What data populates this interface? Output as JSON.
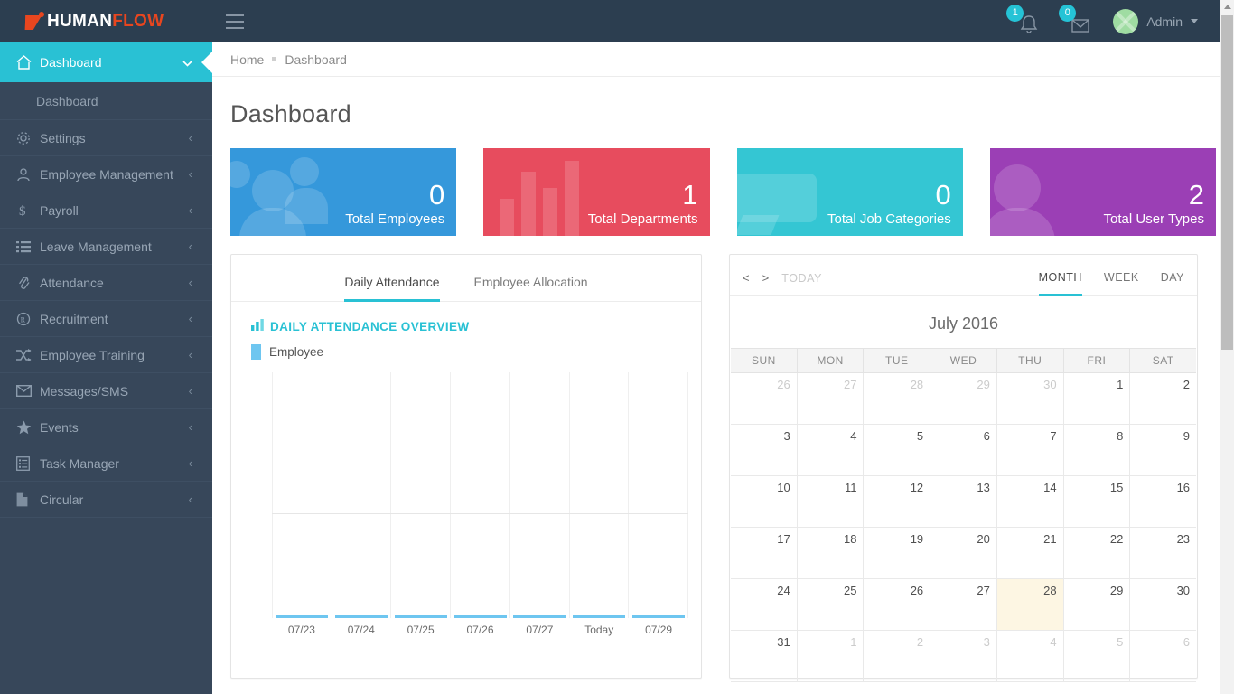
{
  "brand": {
    "name_a": "HUMAN",
    "name_b": "FLOW",
    "logo_icon": "flow-mark-icon"
  },
  "topbar": {
    "menu_toggle": "hamburger-icon",
    "notifications": {
      "icon": "bell-icon",
      "count": "1"
    },
    "messages": {
      "icon": "envelope-icon",
      "count": "0"
    },
    "user": {
      "name": "Admin",
      "avatar": "avatar",
      "caret": "chevron-down-icon"
    }
  },
  "sidebar": {
    "active": {
      "label": "Dashboard",
      "icon": "home-icon",
      "chevron": "chevron-down-icon"
    },
    "submenu": [
      {
        "label": "Dashboard"
      }
    ],
    "items": [
      {
        "label": "Settings",
        "icon": "gear-icon",
        "arrow": "chevron-left-icon"
      },
      {
        "label": "Employee Management",
        "icon": "user-group-icon",
        "arrow": "chevron-left-icon"
      },
      {
        "label": "Payroll",
        "icon": "dollar-icon",
        "arrow": "chevron-left-icon"
      },
      {
        "label": "Leave Management",
        "icon": "list-icon",
        "arrow": "chevron-left-icon"
      },
      {
        "label": "Attendance",
        "icon": "paperclip-icon",
        "arrow": "chevron-left-icon"
      },
      {
        "label": "Recruitment",
        "icon": "registered-icon",
        "arrow": "chevron-left-icon"
      },
      {
        "label": "Employee Training",
        "icon": "shuffle-icon",
        "arrow": "chevron-left-icon"
      },
      {
        "label": "Messages/SMS",
        "icon": "mail-icon",
        "arrow": "chevron-left-icon"
      },
      {
        "label": "Events",
        "icon": "star-icon",
        "arrow": "chevron-left-icon"
      },
      {
        "label": "Task Manager",
        "icon": "tasks-icon",
        "arrow": "chevron-left-icon"
      },
      {
        "label": "Circular",
        "icon": "file-icon",
        "arrow": "chevron-left-icon"
      }
    ]
  },
  "breadcrumb": {
    "home": "Home",
    "current": "Dashboard"
  },
  "page": {
    "title": "Dashboard"
  },
  "cards": [
    {
      "value": "0",
      "label": "Total Employees",
      "color": "#3598db",
      "icon": "people-icon"
    },
    {
      "value": "1",
      "label": "Total Departments",
      "color": "#e74c5e",
      "icon": "bar-chart-icon"
    },
    {
      "value": "0",
      "label": "Total Job Categories",
      "color": "#34c6d3",
      "icon": "screen-icon"
    },
    {
      "value": "2",
      "label": "Total User Types",
      "color": "#9b3fb5",
      "icon": "user-icon"
    }
  ],
  "chart_panel": {
    "tabs": [
      {
        "label": "Daily Attendance",
        "active": true
      },
      {
        "label": "Employee Allocation",
        "active": false
      }
    ],
    "heading": "DAILY ATTENDANCE OVERVIEW",
    "heading_icon": "bar-chart-icon",
    "legend_label": "Employee"
  },
  "chart_data": {
    "type": "bar",
    "title": "DAILY ATTENDANCE OVERVIEW",
    "categories": [
      "07/23",
      "07/24",
      "07/25",
      "07/26",
      "07/27",
      "Today",
      "07/29"
    ],
    "series": [
      {
        "name": "Employee",
        "color": "#6ec6f0",
        "values": [
          0,
          0,
          0,
          0,
          0,
          0,
          0
        ]
      }
    ],
    "xlabel": "",
    "ylabel": "",
    "ylim": [
      0,
      1
    ],
    "grid": "vertical",
    "legend_position": "top-left"
  },
  "calendar": {
    "prev": "<",
    "next": ">",
    "today_button": "TODAY",
    "views": [
      {
        "label": "MONTH",
        "active": true
      },
      {
        "label": "WEEK",
        "active": false
      },
      {
        "label": "DAY",
        "active": false
      }
    ],
    "title": "July 2016",
    "dow": [
      "SUN",
      "MON",
      "TUE",
      "WED",
      "THU",
      "FRI",
      "SAT"
    ],
    "weeks": [
      [
        {
          "d": "26",
          "o": true
        },
        {
          "d": "27",
          "o": true
        },
        {
          "d": "28",
          "o": true
        },
        {
          "d": "29",
          "o": true
        },
        {
          "d": "30",
          "o": true
        },
        {
          "d": "1"
        },
        {
          "d": "2"
        }
      ],
      [
        {
          "d": "3"
        },
        {
          "d": "4"
        },
        {
          "d": "5"
        },
        {
          "d": "6"
        },
        {
          "d": "7"
        },
        {
          "d": "8"
        },
        {
          "d": "9"
        }
      ],
      [
        {
          "d": "10"
        },
        {
          "d": "11"
        },
        {
          "d": "12"
        },
        {
          "d": "13"
        },
        {
          "d": "14"
        },
        {
          "d": "15"
        },
        {
          "d": "16"
        }
      ],
      [
        {
          "d": "17"
        },
        {
          "d": "18"
        },
        {
          "d": "19"
        },
        {
          "d": "20"
        },
        {
          "d": "21"
        },
        {
          "d": "22"
        },
        {
          "d": "23"
        }
      ],
      [
        {
          "d": "24"
        },
        {
          "d": "25"
        },
        {
          "d": "26"
        },
        {
          "d": "27"
        },
        {
          "d": "28",
          "t": true
        },
        {
          "d": "29"
        },
        {
          "d": "30"
        }
      ],
      [
        {
          "d": "31"
        },
        {
          "d": "1",
          "o": true
        },
        {
          "d": "2",
          "o": true
        },
        {
          "d": "3",
          "o": true
        },
        {
          "d": "4",
          "o": true
        },
        {
          "d": "5",
          "o": true
        },
        {
          "d": "6",
          "o": true
        }
      ]
    ]
  },
  "theme": {
    "sidebar_bg": "#37475a",
    "topbar_bg": "#2c3e50",
    "accent": "#29c1d4",
    "brand_orange": "#e8461f",
    "today_highlight": "#fdf6e3"
  }
}
